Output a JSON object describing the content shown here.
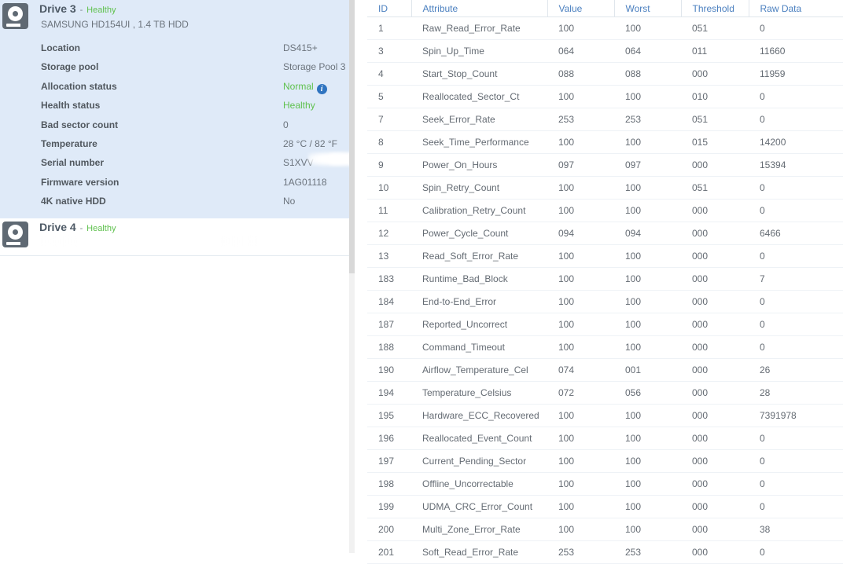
{
  "left_panel": {
    "drives": [
      {
        "name": "Drive 3",
        "separator": "-",
        "status": "Healthy",
        "model": "SAMSUNG HD154UI , 1.4 TB HDD",
        "selected": true,
        "details": [
          {
            "label": "Location",
            "value": "DS415+",
            "green": false,
            "info": false
          },
          {
            "label": "Storage pool",
            "value": "Storage Pool 3",
            "green": false,
            "info": false
          },
          {
            "label": "Allocation status",
            "value": "Normal",
            "green": true,
            "info": true,
            "info_icon": "info-icon"
          },
          {
            "label": "Health status",
            "value": "Healthy",
            "green": true,
            "info": false
          },
          {
            "label": "Bad sector count",
            "value": "0",
            "green": false,
            "info": false
          },
          {
            "label": "Temperature",
            "value": "28 °C / 82 °F",
            "green": false,
            "info": false
          },
          {
            "label": "Serial number",
            "value": "S1XVV",
            "green": false,
            "info": false,
            "redacted": true
          },
          {
            "label": "Firmware version",
            "value": "1AG01118",
            "green": false,
            "info": false
          },
          {
            "label": "4K native HDD",
            "value": "No",
            "green": false,
            "info": false
          }
        ]
      },
      {
        "name": "Drive 4",
        "separator": "-",
        "status": "Healthy",
        "model": "",
        "selected": false,
        "details": []
      }
    ],
    "icons": {
      "drive": "hard-drive-icon"
    },
    "colors": {
      "selected_row": "#dfeaf8",
      "status_healthy": "#5fc14e",
      "info_badge": "#2f74c0",
      "header_text": "#4a7fbf"
    }
  },
  "smart_table": {
    "columns": [
      "ID",
      "Attribute",
      "Value",
      "Worst",
      "Threshold",
      "Raw Data"
    ],
    "rows": [
      {
        "id": "1",
        "attribute": "Raw_Read_Error_Rate",
        "value": "100",
        "worst": "100",
        "threshold": "051",
        "raw": "0"
      },
      {
        "id": "3",
        "attribute": "Spin_Up_Time",
        "value": "064",
        "worst": "064",
        "threshold": "011",
        "raw": "11660"
      },
      {
        "id": "4",
        "attribute": "Start_Stop_Count",
        "value": "088",
        "worst": "088",
        "threshold": "000",
        "raw": "11959"
      },
      {
        "id": "5",
        "attribute": "Reallocated_Sector_Ct",
        "value": "100",
        "worst": "100",
        "threshold": "010",
        "raw": "0"
      },
      {
        "id": "7",
        "attribute": "Seek_Error_Rate",
        "value": "253",
        "worst": "253",
        "threshold": "051",
        "raw": "0"
      },
      {
        "id": "8",
        "attribute": "Seek_Time_Performance",
        "value": "100",
        "worst": "100",
        "threshold": "015",
        "raw": "14200"
      },
      {
        "id": "9",
        "attribute": "Power_On_Hours",
        "value": "097",
        "worst": "097",
        "threshold": "000",
        "raw": "15394"
      },
      {
        "id": "10",
        "attribute": "Spin_Retry_Count",
        "value": "100",
        "worst": "100",
        "threshold": "051",
        "raw": "0"
      },
      {
        "id": "11",
        "attribute": "Calibration_Retry_Count",
        "value": "100",
        "worst": "100",
        "threshold": "000",
        "raw": "0"
      },
      {
        "id": "12",
        "attribute": "Power_Cycle_Count",
        "value": "094",
        "worst": "094",
        "threshold": "000",
        "raw": "6466"
      },
      {
        "id": "13",
        "attribute": "Read_Soft_Error_Rate",
        "value": "100",
        "worst": "100",
        "threshold": "000",
        "raw": "0"
      },
      {
        "id": "183",
        "attribute": "Runtime_Bad_Block",
        "value": "100",
        "worst": "100",
        "threshold": "000",
        "raw": "7"
      },
      {
        "id": "184",
        "attribute": "End-to-End_Error",
        "value": "100",
        "worst": "100",
        "threshold": "000",
        "raw": "0"
      },
      {
        "id": "187",
        "attribute": "Reported_Uncorrect",
        "value": "100",
        "worst": "100",
        "threshold": "000",
        "raw": "0"
      },
      {
        "id": "188",
        "attribute": "Command_Timeout",
        "value": "100",
        "worst": "100",
        "threshold": "000",
        "raw": "0"
      },
      {
        "id": "190",
        "attribute": "Airflow_Temperature_Cel",
        "value": "074",
        "worst": "001",
        "threshold": "000",
        "raw": "26"
      },
      {
        "id": "194",
        "attribute": "Temperature_Celsius",
        "value": "072",
        "worst": "056",
        "threshold": "000",
        "raw": "28"
      },
      {
        "id": "195",
        "attribute": "Hardware_ECC_Recovered",
        "value": "100",
        "worst": "100",
        "threshold": "000",
        "raw": "7391978"
      },
      {
        "id": "196",
        "attribute": "Reallocated_Event_Count",
        "value": "100",
        "worst": "100",
        "threshold": "000",
        "raw": "0"
      },
      {
        "id": "197",
        "attribute": "Current_Pending_Sector",
        "value": "100",
        "worst": "100",
        "threshold": "000",
        "raw": "0"
      },
      {
        "id": "198",
        "attribute": "Offline_Uncorrectable",
        "value": "100",
        "worst": "100",
        "threshold": "000",
        "raw": "0"
      },
      {
        "id": "199",
        "attribute": "UDMA_CRC_Error_Count",
        "value": "100",
        "worst": "100",
        "threshold": "000",
        "raw": "0"
      },
      {
        "id": "200",
        "attribute": "Multi_Zone_Error_Rate",
        "value": "100",
        "worst": "100",
        "threshold": "000",
        "raw": "38"
      },
      {
        "id": "201",
        "attribute": "Soft_Read_Error_Rate",
        "value": "253",
        "worst": "253",
        "threshold": "000",
        "raw": "0"
      }
    ]
  }
}
